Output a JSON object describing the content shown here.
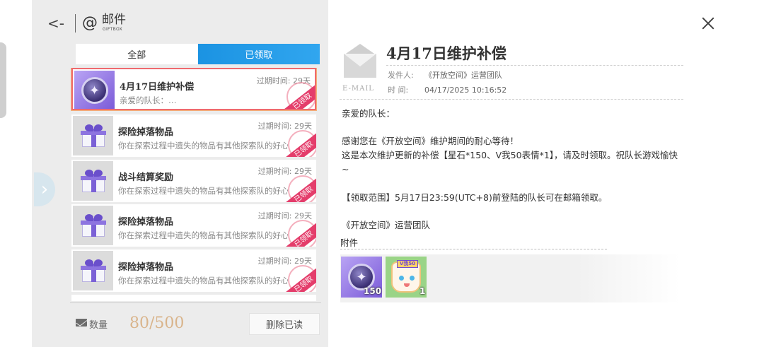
{
  "header": {
    "title": "邮件",
    "subtitle": "GIFTBOX",
    "back_glyph": "<-",
    "at_glyph": "@"
  },
  "tabs": [
    {
      "label": "全部",
      "active": false
    },
    {
      "label": "已领取",
      "active": true
    }
  ],
  "mail_list": [
    {
      "title": "4月17日维护补偿",
      "preview": "亲爱的队长：…",
      "expire": "过期时间: 29天",
      "stamp": "已领取",
      "icon": "star-orb-icon",
      "selected": true
    },
    {
      "title": "探险掉落物品",
      "preview": "你在探索过程中遗失的物品有其他探索队的好心",
      "expire": "过期时间: 29天",
      "stamp": "已领取",
      "icon": "gift-box-icon",
      "selected": false
    },
    {
      "title": "战斗结算奖励",
      "preview": "你在探索过程中遗失的物品有其他探索队的好心",
      "expire": "过期时间: 29天",
      "stamp": "已领取",
      "icon": "gift-box-icon",
      "selected": false
    },
    {
      "title": "探险掉落物品",
      "preview": "你在探索过程中遗失的物品有其他探索队的好心",
      "expire": "过期时间: 29天",
      "stamp": "已领取",
      "icon": "gift-box-icon",
      "selected": false
    },
    {
      "title": "探险掉落物品",
      "preview": "你在探索过程中遗失的物品有其他探索队的好心",
      "expire": "过期时间: 29天",
      "stamp": "已领取",
      "icon": "gift-box-icon",
      "selected": false
    }
  ],
  "footer": {
    "count_label": "数量",
    "count_value": "80/500",
    "delete_label": "删除已读"
  },
  "detail": {
    "email_label": "E-MAIL",
    "title": "4月17日维护补偿",
    "sender_key": "发件人:",
    "sender_value": "《开放空间》运营团队",
    "time_key": "时  间:",
    "time_value": "04/17/2025 10:16:52",
    "greeting": "亲爱的队长：",
    "para1": "感谢您在《开放空间》维护期间的耐心等待！",
    "para2": "这是本次维护更新的补偿【星石*150、V我50表情*1】，请及时领取。祝队长游戏愉快~",
    "para3": "【领取范围】5月17日23:59(UTC+8)前登陆的队长可在邮箱领取。",
    "signature": "《开放空间》运营团队",
    "attachments_label": "附件",
    "attachments": [
      {
        "name": "star-stone-icon",
        "qty": "150"
      },
      {
        "name": "v50-emoji-icon",
        "tag": "V我50",
        "qty": "1"
      }
    ]
  },
  "colors": {
    "accent_blue": "#1b93e2",
    "stamp_red": "#e43d6b",
    "count_gold": "#d9b48b",
    "selected_border": "#ef6a6e"
  }
}
